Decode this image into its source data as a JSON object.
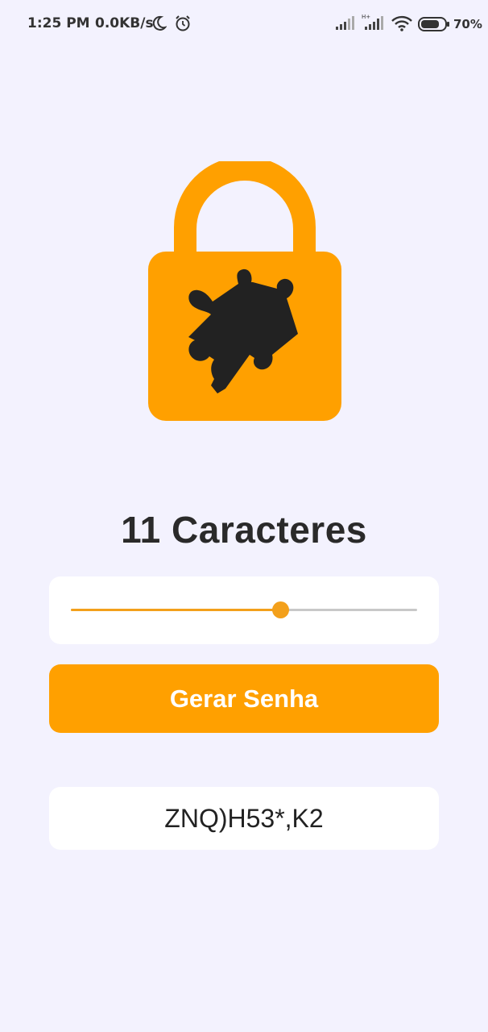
{
  "status_bar": {
    "time": "1:25 PM",
    "net_speed": "0.0KB/s",
    "battery": "70%",
    "icons": [
      "moon-icon",
      "alarm-icon",
      "signal-icon",
      "hplus-signal-icon",
      "wifi-icon",
      "battery-icon"
    ]
  },
  "hero": {
    "icon": "lock-puzzle-icon",
    "accent_color": "#ffa000",
    "puzzle_color": "#222222"
  },
  "length_label": "11 Caracteres",
  "slider": {
    "value": 11,
    "fraction": 0.605,
    "color": "#f3a01b"
  },
  "generate_button": {
    "label": "Gerar Senha",
    "color": "#ffa000"
  },
  "password": "ZNQ)H53*,K2"
}
